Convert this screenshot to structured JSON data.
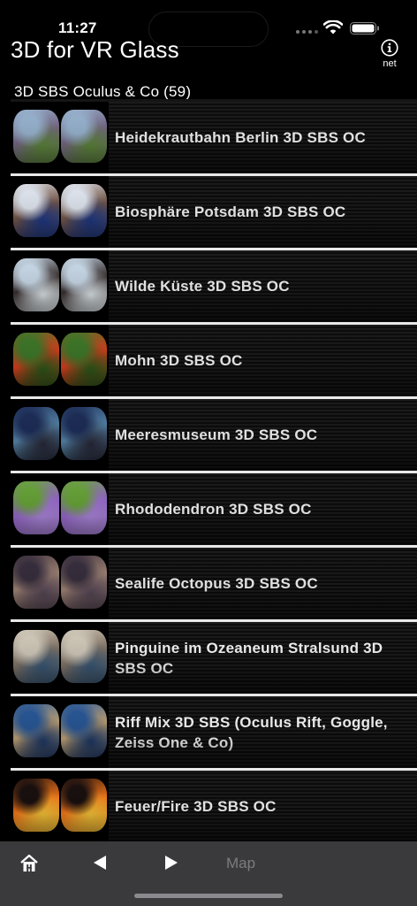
{
  "status_bar": {
    "time": "11:27"
  },
  "nav": {
    "title": "3D for VR Glass",
    "info_label": "net"
  },
  "section": {
    "header": "3D SBS Oculus & Co (59)"
  },
  "items": [
    {
      "title": "Heidekrautbahn Berlin 3D SBS OC",
      "palette": [
        "#9db9d6",
        "#7a6a8a",
        "#5f8a3a"
      ]
    },
    {
      "title": "Biosphäre Potsdam 3D SBS OC",
      "palette": [
        "#e8eef8",
        "#7a5a4a",
        "#1e3a8a"
      ]
    },
    {
      "title": "Wilde Küste 3D SBS OC",
      "palette": [
        "#cfe0ef",
        "#3a3030",
        "#e8f0f4"
      ]
    },
    {
      "title": "Mohn 3D SBS OC",
      "palette": [
        "#3f7a2a",
        "#e0401e",
        "#2a5a1a"
      ]
    },
    {
      "title": "Meeresmuseum 3D SBS OC",
      "palette": [
        "#1e2f5a",
        "#5a8ab0",
        "#2a2a3a"
      ]
    },
    {
      "title": "Rhododendron 3D SBS OC",
      "palette": [
        "#6aa83a",
        "#9a6ad0",
        "#b08ae0"
      ]
    },
    {
      "title": "Sealife Octopus 3D SBS OC",
      "palette": [
        "#3a3040",
        "#a88a7a",
        "#5a4a5a"
      ]
    },
    {
      "title": "Pinguine im Ozeaneum Stralsund 3D SBS OC",
      "palette": [
        "#d8d0c0",
        "#8a7a6a",
        "#3a5a7a"
      ]
    },
    {
      "title": "Riff Mix 3D SBS (Oculus Rift, Goggle, Zeiss One & Co)",
      "palette": [
        "#2a5a9a",
        "#c8a878",
        "#1e3a6a"
      ]
    },
    {
      "title": "Feuer/Fire 3D SBS OC",
      "palette": [
        "#1a1010",
        "#ff7a1a",
        "#ffcc3a"
      ]
    }
  ],
  "tabbar": {
    "map_label": "Map"
  }
}
